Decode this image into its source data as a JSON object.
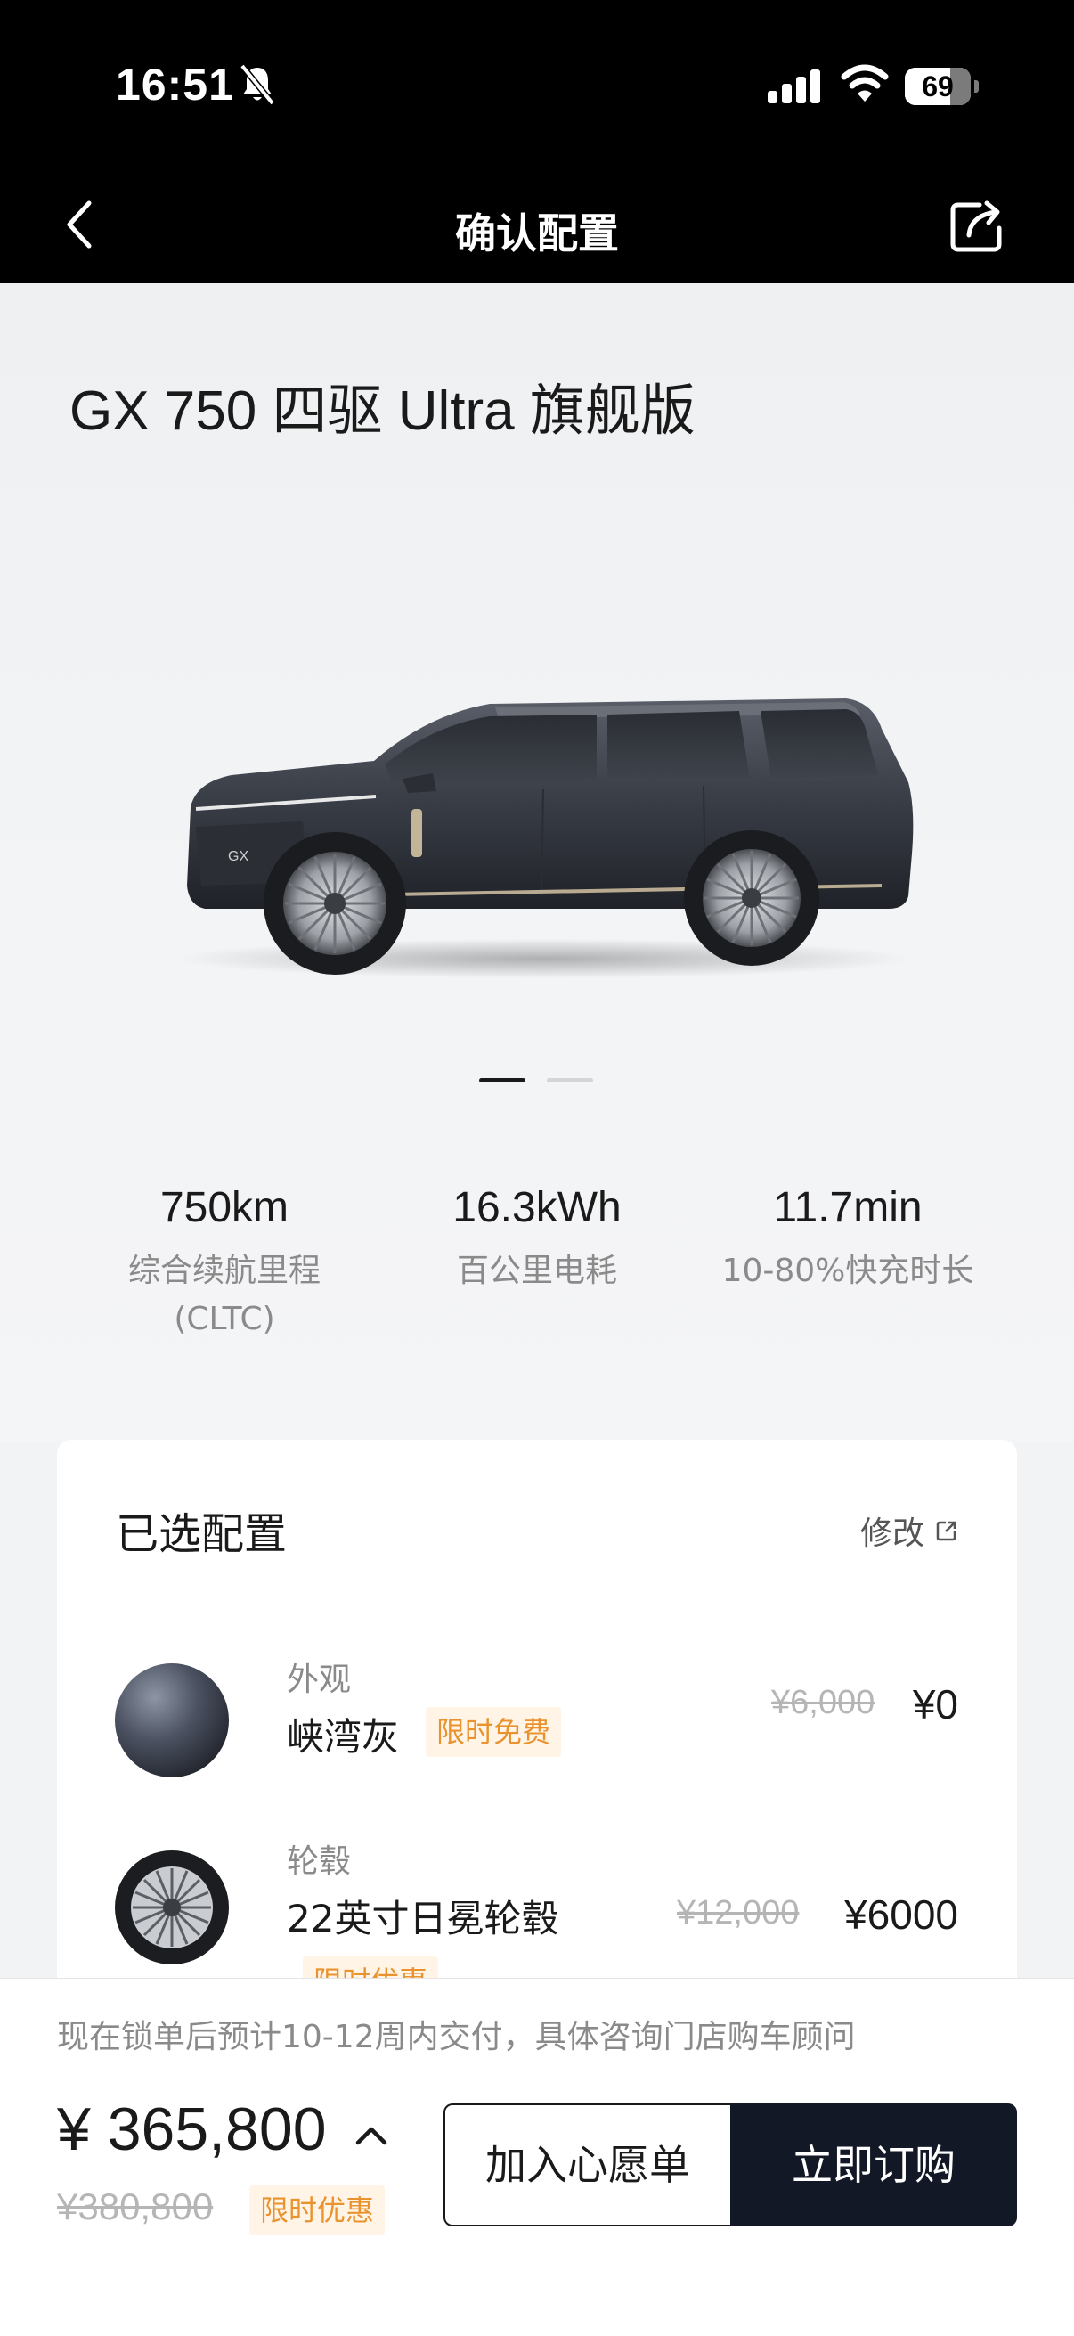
{
  "status_bar": {
    "time": "16:51",
    "battery": "69",
    "battery_level": 0.69
  },
  "nav": {
    "title": "确认配置"
  },
  "model": {
    "title": "GX 750 四驱 Ultra 旗舰版",
    "carousel_active_index": 0,
    "carousel_count": 2
  },
  "stats": [
    {
      "value": "750km",
      "label_line1": "综合续航里程",
      "label_line2": "(CLTC)"
    },
    {
      "value": "16.3kWh",
      "label_line1": "百公里电耗",
      "label_line2": ""
    },
    {
      "value": "11.7min",
      "label_line1": "10-80%快充时长",
      "label_line2": ""
    }
  ],
  "config": {
    "title": "已选配置",
    "modify_label": "修改",
    "items": [
      {
        "category": "外观",
        "name": "峡湾灰",
        "promo": "限时免费",
        "old_price": "¥6,000",
        "price": "¥0"
      },
      {
        "category": "轮毂",
        "name": "22英寸日冕轮毂",
        "promo": "限时优惠",
        "old_price": "¥12,000",
        "price": "¥6000"
      }
    ]
  },
  "footer": {
    "delivery_note": "现在锁单后预计10-12周内交付，具体咨询门店购车顾问",
    "total_price": "¥ 365,800",
    "old_total": "¥380,800",
    "promo": "限时优惠",
    "wishlist_label": "加入心愿单",
    "buy_label": "立即订购"
  },
  "colors": {
    "accent_dark": "#121826",
    "promo_text": "#e9932f",
    "promo_bg": "#fff4e5"
  }
}
